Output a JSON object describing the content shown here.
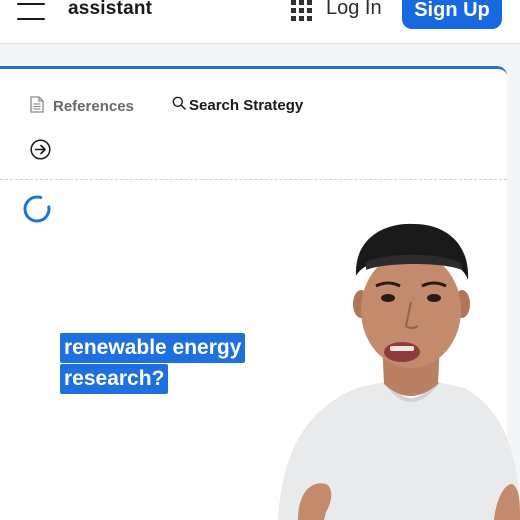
{
  "header": {
    "menu_icon": "hamburger-menu-icon",
    "brand": "assistant",
    "apps_icon": "grid-apps-icon",
    "login_label": "Log In",
    "signup_label": "Sign Up",
    "signup_color": "#1769e0"
  },
  "card": {
    "accent_color": "#2b6fd6",
    "tabs": [
      {
        "label": "References",
        "icon": "document-icon"
      },
      {
        "label": "Search Strategy",
        "icon": "search-icon"
      }
    ],
    "arrow_icon": "arrow-right-circle-icon",
    "loading_icon": "loading-spinner-icon"
  },
  "overlay": {
    "caption_lines": [
      "renewable energy",
      "research?"
    ],
    "caption_bg": "#1e6fdf"
  }
}
